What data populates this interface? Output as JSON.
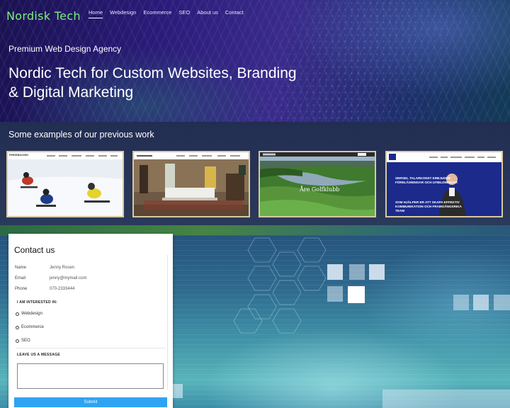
{
  "header": {
    "logo": "Nordisk Tech",
    "nav": [
      "Home",
      "Webdesign",
      "Ecommerce",
      "SEO",
      "About us",
      "Contact"
    ]
  },
  "hero": {
    "tagline": "Premium Web Design Agency",
    "headline": "Nordic Tech for Custom Websites, Branding & Digital Marketing"
  },
  "examples": {
    "title": "Some examples of our previous work",
    "items": [
      {
        "logo": "PERSEBACKEN"
      },
      {
        "logo": ""
      },
      {
        "logo": "",
        "caption": "Åre Golfklubb"
      },
      {
        "logo": "SERGEL TALARKONST",
        "text1": "SERGEL TALARKONST ERBJUDER FÖRELÄSNINGAR OCH UTBILDNINGAR",
        "text2": "SOM HJÄLPER ER ATT SKAPA EFFEKTIV KOMMUNIKATION OCH FRAMGÅNGSRIKA TEAM"
      }
    ]
  },
  "contact": {
    "title": "Contact us",
    "name_label": "Name",
    "name_value": "Jenny Rosen",
    "email_label": "Email",
    "email_value": "jenny@mymail.com",
    "phone_label": "Phone",
    "phone_value": "070-2333444",
    "interest_label": "I AM INTERESTED IN:",
    "options": [
      "Webdesign",
      "Ecommerce",
      "SEO"
    ],
    "message_label": "LEAVE US A MESSAGE",
    "submit": "Submit"
  },
  "colors": {
    "logo": "#7df07a",
    "submit": "#2fa3f2",
    "thumb_border": "#d7c9a0"
  }
}
